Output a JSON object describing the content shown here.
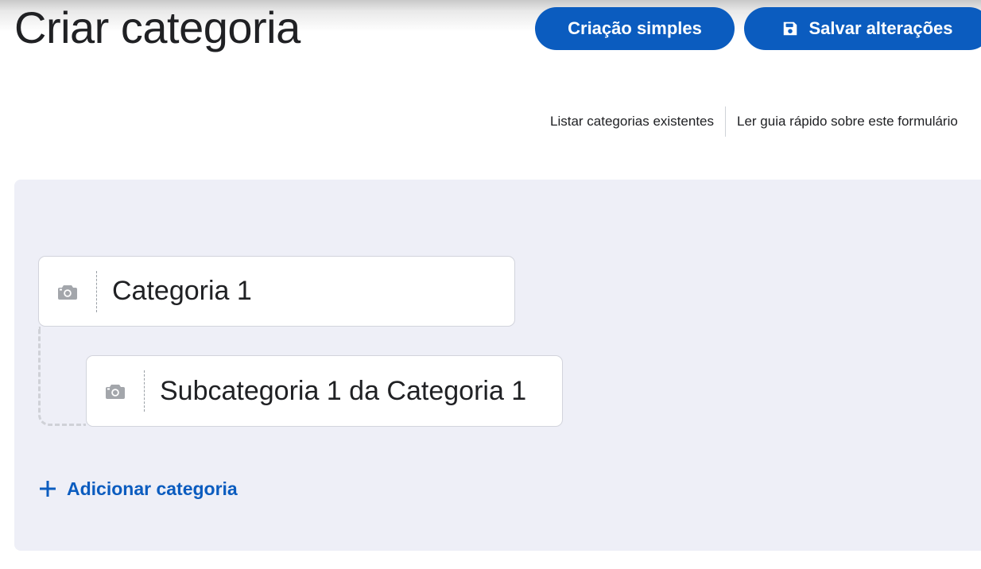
{
  "header": {
    "title": "Criar categoria",
    "simple_button_label": "Criação simples",
    "save_button_label": "Salvar alterações",
    "save_icon": "floppy-disk-icon"
  },
  "links": {
    "list_existing": "Listar categorias existentes",
    "quick_guide": "Ler guia rápido sobre este formulário"
  },
  "categories": [
    {
      "value": "Categoria 1",
      "icon": "camera-icon"
    },
    {
      "value": "Subcategoria 1 da Categoria 1",
      "icon": "camera-icon"
    }
  ],
  "actions": {
    "add_category": "Adicionar categoria",
    "add_icon": "plus-icon"
  },
  "colors": {
    "accent": "#0b5cbf",
    "panel_background": "#eeeff7",
    "icon_gray": "#a3a6ab"
  }
}
